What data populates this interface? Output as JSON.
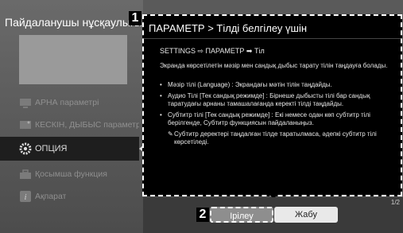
{
  "left_panel": {
    "title": "Пайдаланушы нұсқаулығы",
    "title_badge": "1",
    "menu": [
      {
        "label": "АРНА параметрі",
        "icon": "tv-icon"
      },
      {
        "label": "КЕСКІН, ДЫБЫС параметр",
        "icon": "picture-icon"
      },
      {
        "label": "ОПЦИЯ",
        "icon": "gear-icon",
        "selected": true
      },
      {
        "label": "Қосымша функция",
        "icon": "toolbox-icon"
      },
      {
        "label": "Ақпарат",
        "icon": "info-icon"
      }
    ]
  },
  "dialog": {
    "title": "ПАРАМЕТР > Тілді белгілеу үшін",
    "path": "SETTINGS ⇨ ПАРАМЕТР ➡ Тіл",
    "description": "Экранда көрсетілетін мәзір мен сандық дыбыс тарату тілін таңдауға болады.",
    "bullets": [
      "Мәзір тілі (Language) : Экрандағы мәтін тілін таңдайды.",
      "Аудио Тілі [Тек сандық режимде] : Бірнеше дыбысты тілі бар сандық таратудағы арнаны тамашалағанда керекті тілді таңдайды.",
      "Субтитр тілі [Тек сандық режимде] : Екі немесе одан көп субтитр тілі берілгенде, Субтитр функциясын пайдаланыңыз."
    ],
    "note": "Субтитр деректері таңдалған тілде таратылмаса, әдепкі субтитр тілі көрсетіледі.",
    "note_mark": "✎"
  },
  "footer": {
    "page_indicator": "1/2",
    "badge": "2",
    "prev_label": "Ірілеу",
    "close_label": "Жабу"
  }
}
